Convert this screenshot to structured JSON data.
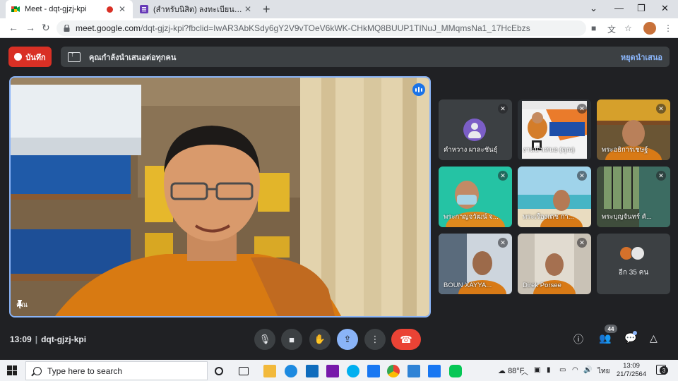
{
  "browser": {
    "tabs": [
      {
        "title": "Meet - dqt-gjzj-kpi",
        "active": true,
        "recording": true
      },
      {
        "title": "(สำหรับนิสิต) ลงทะเบียนเข้าร่วมกิจกรรม",
        "active": false
      }
    ],
    "new_tab": "+",
    "url_host": "meet.google.com",
    "url_path": "/dqt-gjzj-kpi?fbclid=IwAR3AbKSdy6gY2V9vTOeV6kWK-CHkMQ8BUUP1TINuJ_MMqmsNa1_17HcEbzs"
  },
  "meet": {
    "record_label": "บันทึก",
    "presenting_banner": "คุณกำลังนำเสนอต่อทุกคน",
    "stop_presenting": "หยุดนำเสนอ",
    "self_label": "คุณ",
    "participants": [
      {
        "name": "คำหวาง ผาละชันธุ์",
        "type": "avatar"
      },
      {
        "name": "งานนำเสนอ (คุณ)",
        "type": "presentation"
      },
      {
        "name": "พระอธิการเชษฐ์",
        "type": "video"
      },
      {
        "name": "พระกาญจวัฒน์ จ...",
        "type": "video"
      },
      {
        "name": "พระเรืองเดช กา...",
        "type": "video"
      },
      {
        "name": "พระบุญจันทร์ คั...",
        "type": "video"
      },
      {
        "name": "BOUN XAYYA...",
        "type": "video"
      },
      {
        "name": "Direk Porsee",
        "type": "video"
      }
    ],
    "more_participants": "อีก 35 คน",
    "time": "13:09",
    "separator": "|",
    "meeting_code": "dqt-gjzj-kpi",
    "participant_count": "44",
    "colors": {
      "accent": "#8ab4f8",
      "record": "#d93025",
      "hangup": "#ea4335",
      "surface": "#202124",
      "tile": "#3c4043"
    }
  },
  "taskbar": {
    "search_placeholder": "Type here to search",
    "weather": "88°F",
    "language": "ไทย",
    "clock_time": "13:09",
    "clock_date": "21/7/2564",
    "notification_count": "3"
  }
}
